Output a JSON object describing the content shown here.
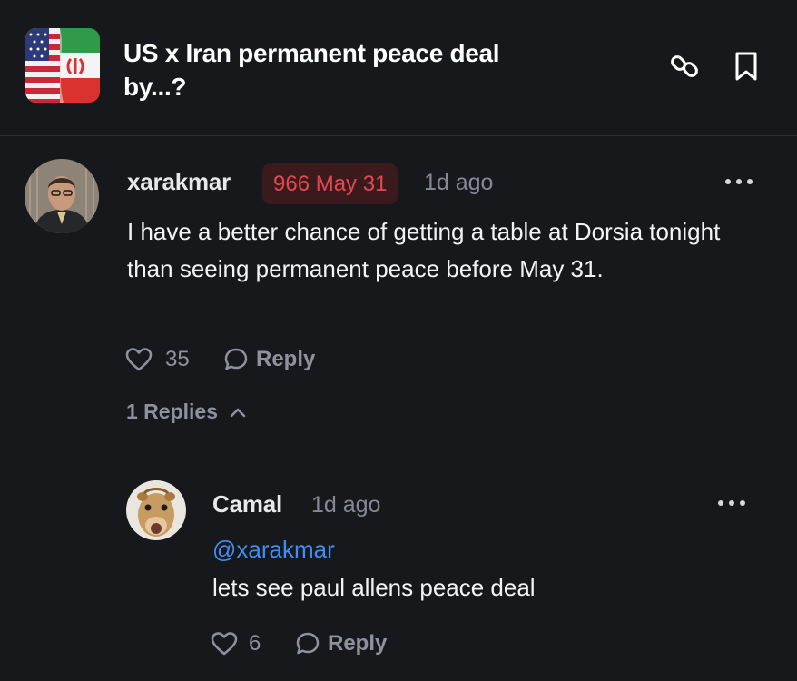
{
  "market": {
    "title": "US x Iran permanent peace deal by...?",
    "thumbnail_icon": "us-iran-flags-image",
    "link_icon": "link-icon",
    "bookmark_icon": "bookmark-icon"
  },
  "comment": {
    "username": "xarakmar",
    "position_badge": "966 May 31",
    "timestamp": "1d ago",
    "text": "I have a better chance of getting a table at Dorsia tonight than seeing permanent peace before May 31.",
    "like_count": "35",
    "reply_label": "Reply",
    "replies_toggle": "1 Replies"
  },
  "reply": {
    "username": "Camal",
    "timestamp": "1d ago",
    "mention": "@xarakmar",
    "text": "lets see paul allens peace deal",
    "like_count": "6",
    "reply_label": "Reply"
  },
  "colors": {
    "background": "#17181c",
    "badge_bg": "#3b1a1e",
    "badge_text": "#e04a4e",
    "mention": "#3d8ff5",
    "muted": "#8e929c"
  }
}
